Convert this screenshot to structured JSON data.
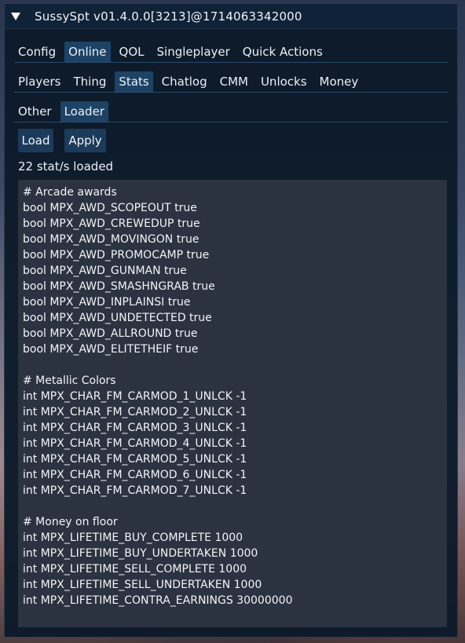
{
  "window": {
    "title": "SussySpt v01.4.0.0[3213]@1714063342000"
  },
  "tabs_main": [
    "Config",
    "Online",
    "QOL",
    "Singleplayer",
    "Quick Actions"
  ],
  "tabs_main_active": "Online",
  "tabs_online": [
    "Players",
    "Thing",
    "Stats",
    "Chatlog",
    "CMM",
    "Unlocks",
    "Money"
  ],
  "tabs_online_active": "Stats",
  "tabs_stats": [
    "Other",
    "Loader"
  ],
  "tabs_stats_active": "Loader",
  "buttons": {
    "load": "Load",
    "apply": "Apply"
  },
  "status_text": "22 stat/s loaded",
  "editor_lines": [
    "# Arcade awards",
    "bool MPX_AWD_SCOPEOUT true",
    "bool MPX_AWD_CREWEDUP true",
    "bool MPX_AWD_MOVINGON true",
    "bool MPX_AWD_PROMOCAMP true",
    "bool MPX_AWD_GUNMAN true",
    "bool MPX_AWD_SMASHNGRAB true",
    "bool MPX_AWD_INPLAINSI true",
    "bool MPX_AWD_UNDETECTED true",
    "bool MPX_AWD_ALLROUND true",
    "bool MPX_AWD_ELITETHEIF true",
    "",
    "# Metallic Colors",
    "int MPX_CHAR_FM_CARMOD_1_UNLCK -1",
    "int MPX_CHAR_FM_CARMOD_2_UNLCK -1",
    "int MPX_CHAR_FM_CARMOD_3_UNLCK -1",
    "int MPX_CHAR_FM_CARMOD_4_UNLCK -1",
    "int MPX_CHAR_FM_CARMOD_5_UNLCK -1",
    "int MPX_CHAR_FM_CARMOD_6_UNLCK -1",
    "int MPX_CHAR_FM_CARMOD_7_UNLCK -1",
    "",
    "# Money on floor",
    "int MPX_LIFETIME_BUY_COMPLETE 1000",
    "int MPX_LIFETIME_BUY_UNDERTAKEN 1000",
    "int MPX_LIFETIME_SELL_COMPLETE 1000",
    "int MPX_LIFETIME_SELL_UNDERTAKEN 1000",
    "int MPX_LIFETIME_CONTRA_EARNINGS 30000000"
  ],
  "colors": {
    "window_bg": "#0c1a2a",
    "tab_active": "#1d4266",
    "button": "#1c3a5a",
    "editor_bg": "#2b3240"
  }
}
